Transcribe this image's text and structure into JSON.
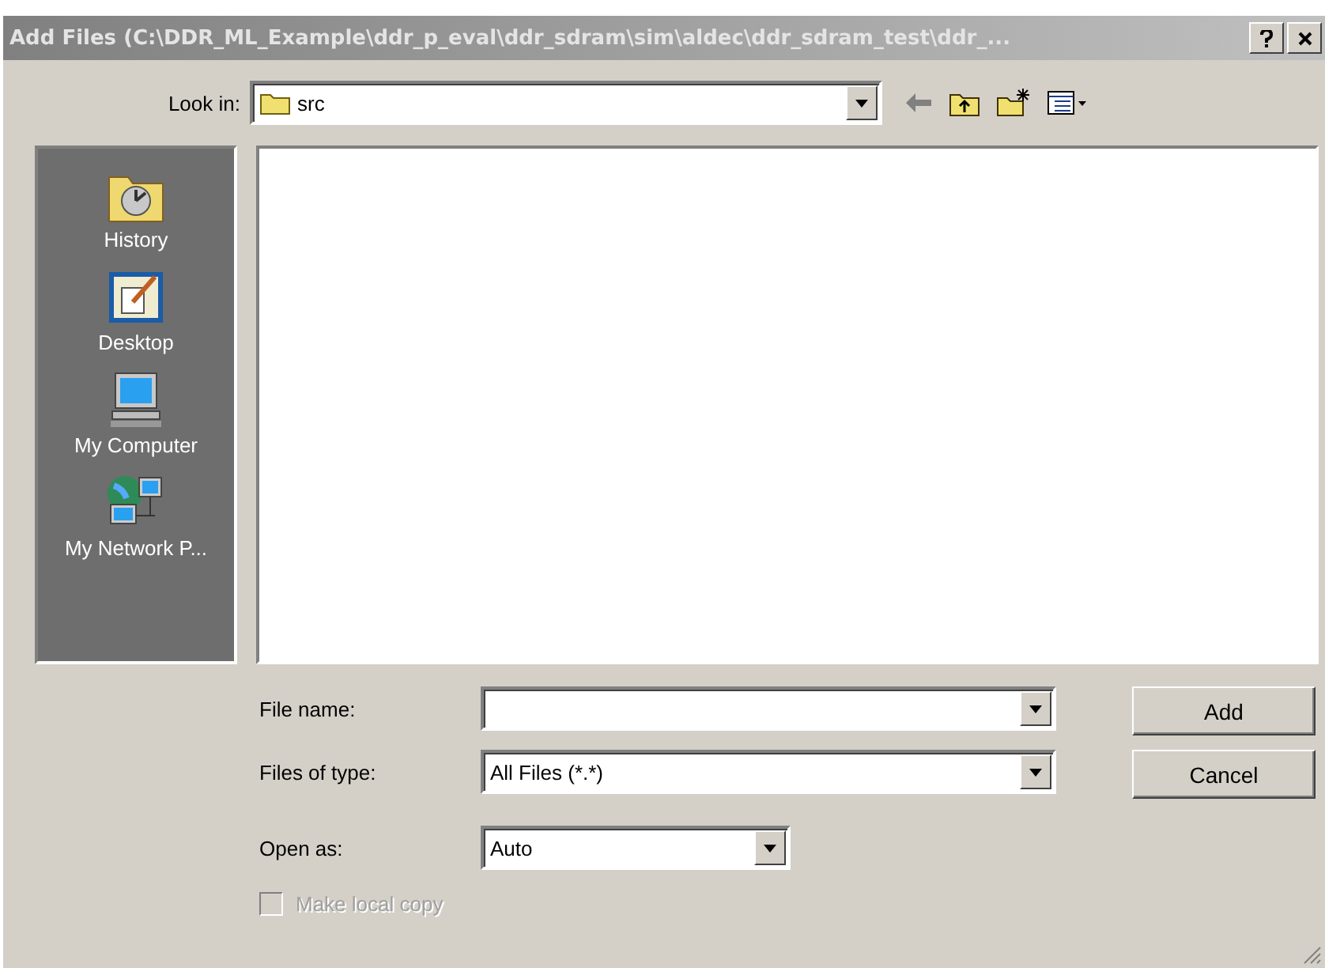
{
  "window": {
    "title": "Add Files (C:\\DDR_ML_Example\\ddr_p_eval\\ddr_sdram\\sim\\aldec\\ddr_sdram_test\\ddr_...",
    "active": false
  },
  "look_in": {
    "label": "Look in:",
    "value": "src"
  },
  "places": [
    {
      "label": "History",
      "selected": false
    },
    {
      "label": "Desktop",
      "selected": false
    },
    {
      "label": "My Computer",
      "selected": false
    },
    {
      "label": "My Network P...",
      "selected": false
    }
  ],
  "fields": [
    {
      "label": "File name:"
    },
    {
      "label": "Files of type:",
      "value": "All Files (*.*)"
    }
  ],
  "open_as": {
    "label": "Open as:",
    "value": "Auto"
  },
  "make_local_copy": {
    "label": "Make local copy",
    "checked": false,
    "disabled": true
  },
  "buttons": [
    {
      "label": "Add"
    },
    {
      "label": "Cancel"
    }
  ]
}
